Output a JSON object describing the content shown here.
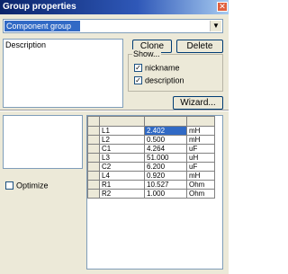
{
  "window": {
    "title": "Group properties",
    "close_glyph": "✕"
  },
  "combo": {
    "value": "Component group",
    "arrow_glyph": "▼"
  },
  "description": {
    "label": "Description"
  },
  "buttons": {
    "clone": "Clone",
    "delete": "Delete",
    "wizard": "Wizard..."
  },
  "show": {
    "legend": "Show...",
    "nickname": {
      "label": "nickname",
      "checked": true
    },
    "description": {
      "label": "description",
      "checked": true
    }
  },
  "optimize": {
    "label": "Optimize",
    "checked": false
  },
  "grid": {
    "columns": [
      "",
      "",
      "",
      ""
    ],
    "rows": [
      {
        "name": "L1",
        "value": "2.402",
        "unit": "mH"
      },
      {
        "name": "L2",
        "value": "0.500",
        "unit": "mH"
      },
      {
        "name": "C1",
        "value": "4.264",
        "unit": "uF"
      },
      {
        "name": "L3",
        "value": "51.000",
        "unit": "uH"
      },
      {
        "name": "C2",
        "value": "6.200",
        "unit": "uF"
      },
      {
        "name": "L4",
        "value": "0.920",
        "unit": "mH"
      },
      {
        "name": "R1",
        "value": "10.527",
        "unit": "Ohm"
      },
      {
        "name": "R2",
        "value": "1.000",
        "unit": "Ohm"
      }
    ]
  }
}
